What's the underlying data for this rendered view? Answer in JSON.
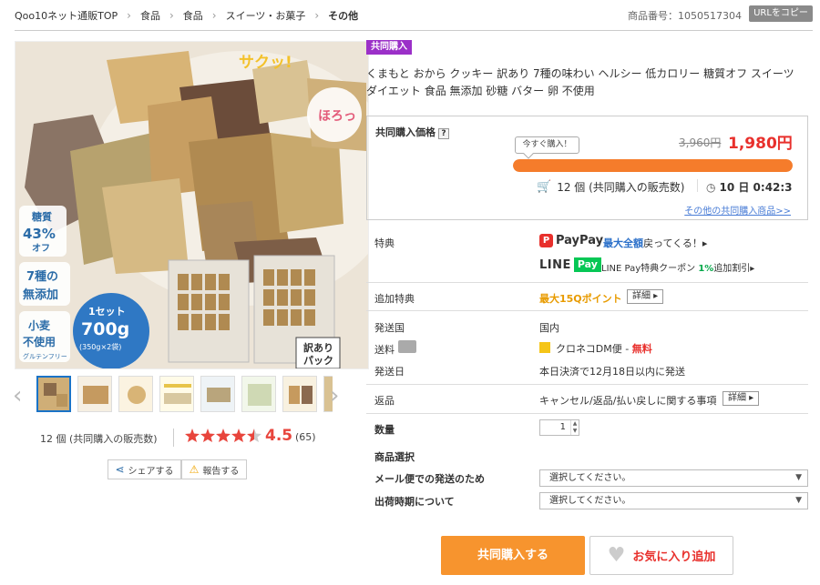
{
  "breadcrumb": {
    "items": [
      "Qoo10ネット通販TOP",
      "食品",
      "食品",
      "スイーツ・お菓子",
      "その他"
    ]
  },
  "product_number": "商品番号：1050517304",
  "copy_url_label": "URLをコピー",
  "image": {
    "banners": [
      "サクッ!",
      "ほろっ",
      "糖質",
      "43%",
      "オフ",
      "7種の",
      "無添加",
      "小麦",
      "不使用",
      "グルテンフリー",
      "1セット",
      "700g",
      "(350g×2袋)",
      "訳あり",
      "パック"
    ]
  },
  "thumbnails_count": 8,
  "sold_text": "12 個 (共同購入の販売数)",
  "rating": {
    "stars": 4.5,
    "value": "4.5",
    "count": "(65)"
  },
  "share_label": "シェアする",
  "report_label": "報告する",
  "badge": "共同購入",
  "title": "くまもと おから クッキー 訳あり 7種の味わい ヘルシー 低カロリー 糖質オフ スイーツ ダイエット 食品 無添加 砂糖 バター 卵 不使用",
  "price": {
    "label": "共同購入価格",
    "help": "?",
    "bubble": "今すぐ購入！",
    "old": "3,960円",
    "new": "1,980円",
    "progress": 1.0,
    "sold": "12 個 (共同購入の販売数)",
    "timer": "10 日 0:42:3",
    "other_link": "その他の共同購入商品>>"
  },
  "benefits": {
    "label": "特典",
    "paypay_logo": "PayPay",
    "paypay_emph": "最大全額",
    "paypay_text": "戻ってくる！▸",
    "line_logo": "LINE",
    "line_pay": "Pay",
    "line_text_a": "LINE Pay特典クーポン ",
    "line_emph": "1%",
    "line_text_b": "追加割引▸"
  },
  "extra": {
    "label": "追加特典",
    "points": "最大15Qポイント",
    "detail": "詳細 ▸"
  },
  "ship_country": {
    "label": "発送国",
    "value": "国内"
  },
  "shipping": {
    "label": "送料",
    "carrier": "クロネコDM便 - ",
    "free": "無料"
  },
  "ship_date": {
    "label": "発送日",
    "value": "本日決済で12月18日以内に発送"
  },
  "returns": {
    "label": "返品",
    "value": "キャンセル/返品/払い戻しに関する事項",
    "detail": "詳細 ▸"
  },
  "quantity": {
    "label": "数量",
    "value": "1"
  },
  "options": {
    "label": "商品選択",
    "mail_label": "メール便での発送のため",
    "mail_value": "選択してください。",
    "time_label": "出荷時期について",
    "time_value": "選択してください。"
  },
  "buttons": {
    "buy": "共同購入する",
    "fav": "お気に入り追加"
  },
  "colors": {
    "accent": "#f7942e",
    "price_red": "#e8302c",
    "badge_purple": "#9b30c8",
    "line_green": "#06c755"
  }
}
